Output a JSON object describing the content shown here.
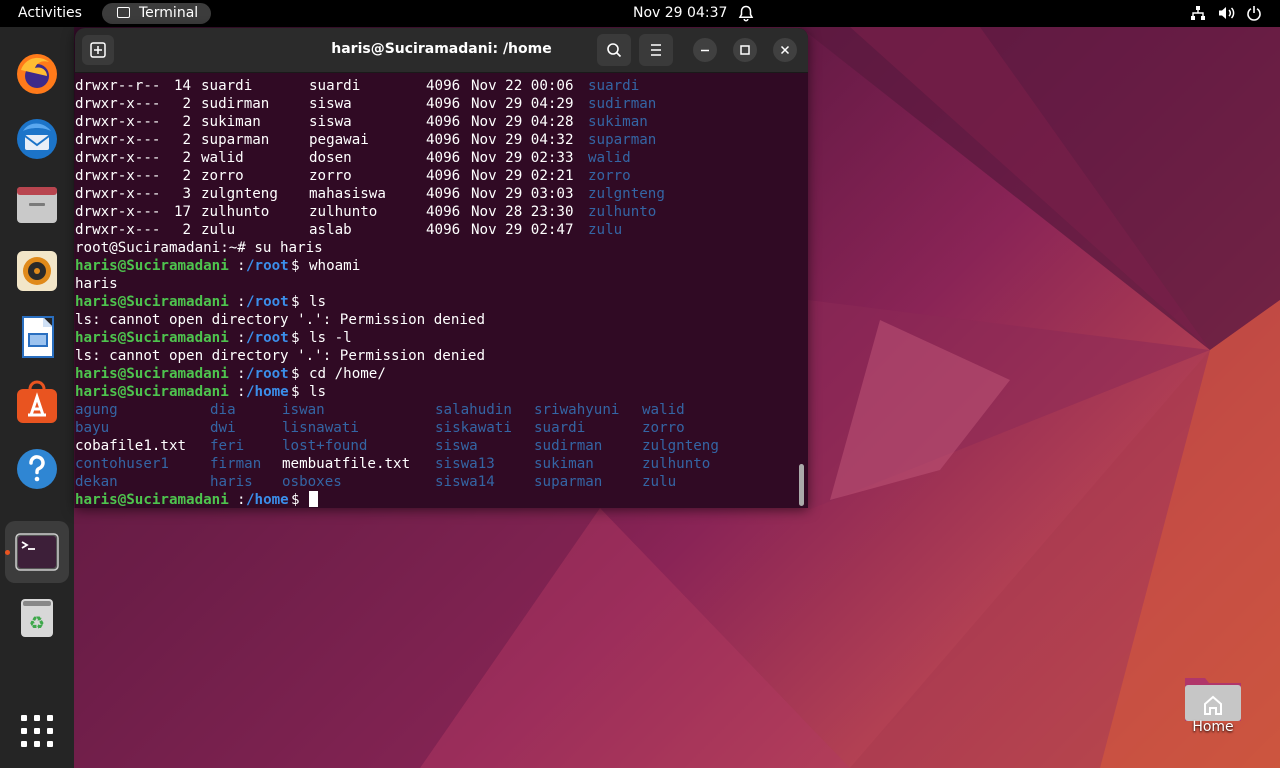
{
  "topbar": {
    "activities": "Activities",
    "app_name": "Terminal",
    "clock": "Nov 29  04:37"
  },
  "dock": {
    "items": [
      "firefox-icon",
      "thunderbird-icon",
      "files-icon",
      "rhythmbox-icon",
      "writer-icon",
      "software-icon",
      "help-icon",
      "terminal-icon",
      "trash-icon",
      "app-grid-icon"
    ]
  },
  "terminal": {
    "title": "haris@Suciramadani: /home",
    "listing": [
      {
        "perm": "drwxr--r--",
        "links": "14",
        "owner": "suardi",
        "group": "suardi",
        "size": "4096",
        "date": "Nov 22 00:06",
        "name": "suardi"
      },
      {
        "perm": "drwxr-x---",
        "links": " 2",
        "owner": "sudirman",
        "group": "siswa",
        "size": "4096",
        "date": "Nov 29 04:29",
        "name": "sudirman"
      },
      {
        "perm": "drwxr-x---",
        "links": " 2",
        "owner": "sukiman",
        "group": "siswa",
        "size": "4096",
        "date": "Nov 29 04:28",
        "name": "sukiman"
      },
      {
        "perm": "drwxr-x---",
        "links": " 2",
        "owner": "suparman",
        "group": "pegawai",
        "size": "4096",
        "date": "Nov 29 04:32",
        "name": "suparman"
      },
      {
        "perm": "drwxr-x---",
        "links": " 2",
        "owner": "walid",
        "group": "dosen",
        "size": "4096",
        "date": "Nov 29 02:33",
        "name": "walid"
      },
      {
        "perm": "drwxr-x---",
        "links": " 2",
        "owner": "zorro",
        "group": "zorro",
        "size": "4096",
        "date": "Nov 29 02:21",
        "name": "zorro"
      },
      {
        "perm": "drwxr-x---",
        "links": " 3",
        "owner": "zulgnteng",
        "group": "mahasiswa",
        "size": "4096",
        "date": "Nov 29 03:03",
        "name": "zulgnteng"
      },
      {
        "perm": "drwxr-x---",
        "links": "17",
        "owner": "zulhunto",
        "group": "zulhunto",
        "size": "4096",
        "date": "Nov 28 23:30",
        "name": "zulhunto"
      },
      {
        "perm": "drwxr-x---",
        "links": " 2",
        "owner": "zulu",
        "group": "aslab",
        "size": "4096",
        "date": "Nov 29 02:47",
        "name": "zulu"
      }
    ],
    "root_prompt": "root@Suciramadani:~# su haris",
    "user_host": "haris@Suciramadani",
    "cwd_root": "/root",
    "cwd_home": "/home",
    "cmd_whoami": "whoami",
    "out_whoami": "haris",
    "cmd_ls": "ls",
    "err_ls": "ls: cannot open directory '.': Permission denied",
    "cmd_lsl": "ls -l",
    "err_lsl": "ls: cannot open directory '.': Permission denied",
    "cmd_cd": "cd /home/",
    "cmd_ls2": "ls",
    "home_dirs": [
      [
        "agung",
        "dia",
        "iswan",
        "salahudin",
        "sriwahyuni",
        "walid"
      ],
      [
        "bayu",
        "dwi",
        "lisnawati",
        "siskawati",
        "suardi",
        "zorro"
      ],
      [
        "cobafile1.txt",
        "feri",
        "lost+found",
        "siswa",
        "sudirman",
        "zulgnteng"
      ],
      [
        "contohuser1",
        "firman",
        "membuatfile.txt",
        "siswa13",
        "sukiman",
        "zulhunto"
      ],
      [
        "dekan",
        "haris",
        "osboxes",
        "siswa14",
        "suparman",
        "zulu"
      ]
    ],
    "plain_files": [
      "cobafile1.txt",
      "membuatfile.txt"
    ]
  },
  "desktop": {
    "home_label": "Home"
  },
  "colors": {
    "terminal_bg": "#300a24",
    "dir_blue": "#2a7bde",
    "prompt_green": "#4ec44e"
  }
}
